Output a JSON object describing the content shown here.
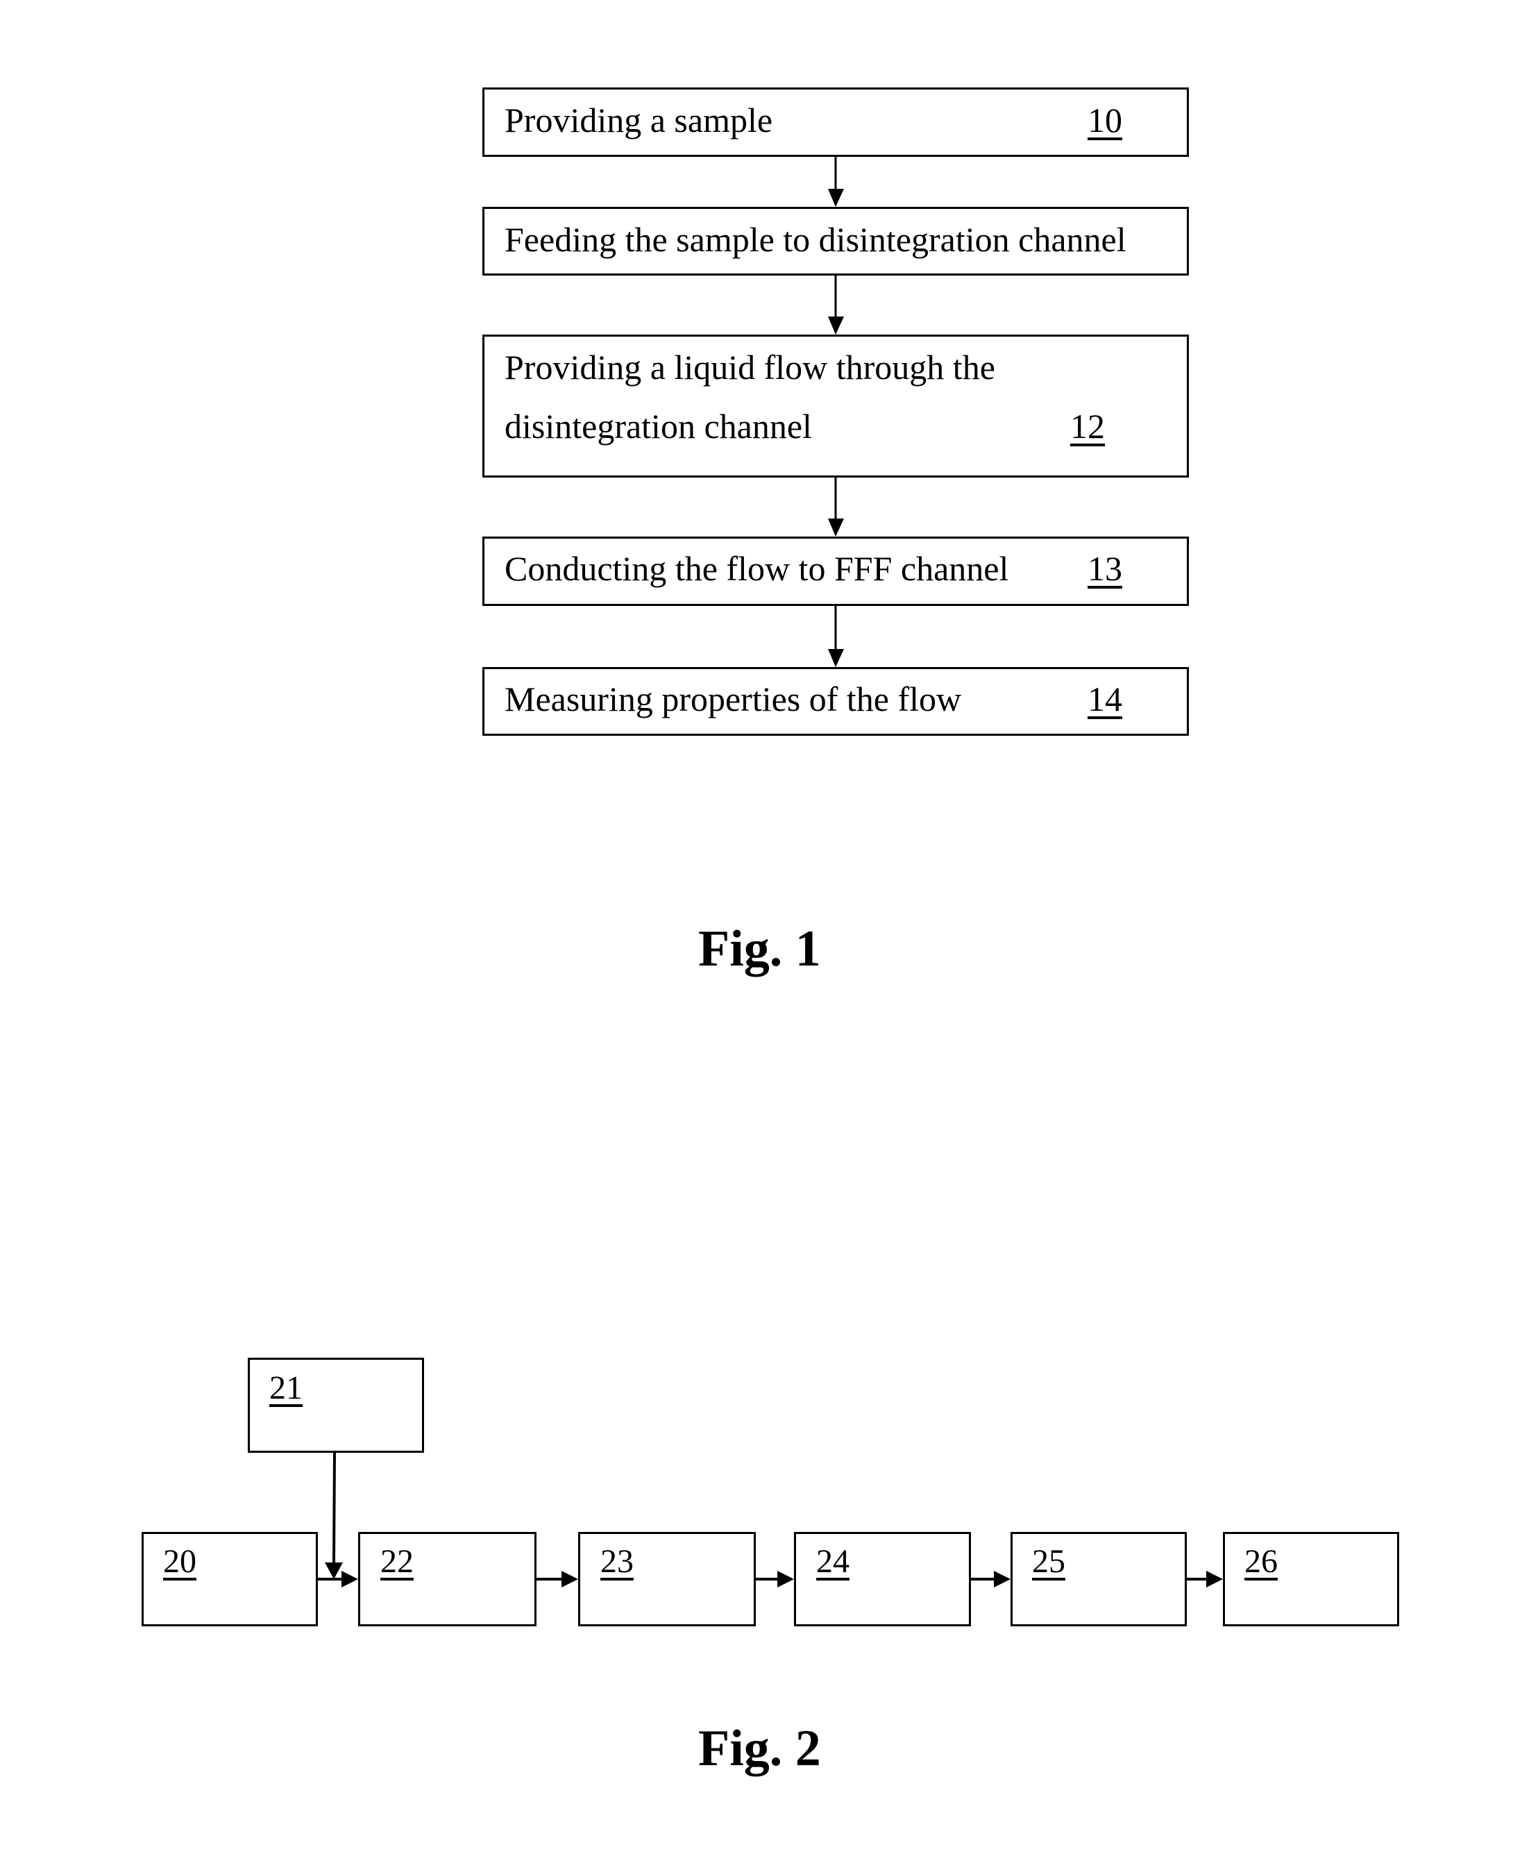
{
  "figure1": {
    "caption": "Fig. 1",
    "steps": [
      {
        "text": "Providing a sample",
        "ref": "10"
      },
      {
        "text": "Feeding the sample to disintegration channel",
        "ref": ""
      },
      {
        "text_line1": "Providing a liquid flow through the",
        "text_line2": "disintegration channel",
        "ref": "12"
      },
      {
        "text": "Conducting the flow to FFF channel",
        "ref": "13"
      },
      {
        "text": "Measuring properties of the flow",
        "ref": "14"
      }
    ]
  },
  "figure2": {
    "caption": "Fig. 2",
    "blocks": [
      {
        "ref": "20"
      },
      {
        "ref": "21"
      },
      {
        "ref": "22"
      },
      {
        "ref": "23"
      },
      {
        "ref": "24"
      },
      {
        "ref": "25"
      },
      {
        "ref": "26"
      }
    ]
  }
}
